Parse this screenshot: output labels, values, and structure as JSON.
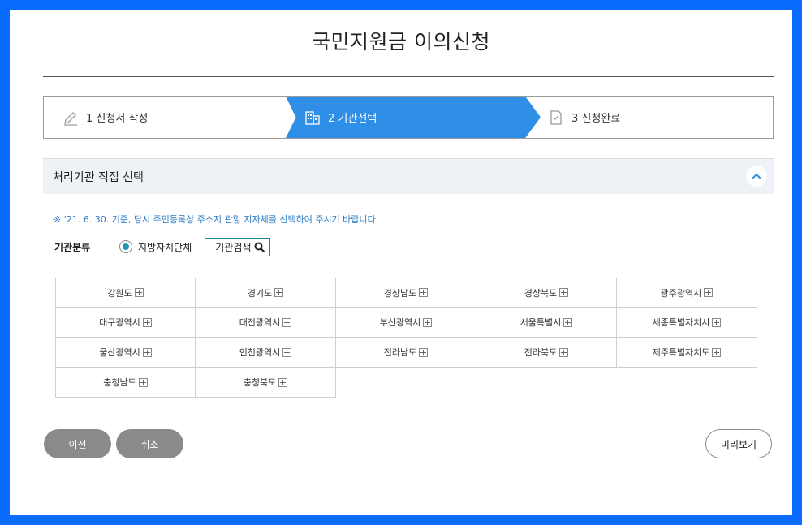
{
  "page": {
    "title": "국민지원금 이의신청"
  },
  "steps": [
    {
      "label": "1 신청서 작성",
      "icon": "pencil-icon",
      "active": false
    },
    {
      "label": "2 기관선택",
      "icon": "building-icon",
      "active": true
    },
    {
      "label": "3 신청완료",
      "icon": "document-check-icon",
      "active": false
    }
  ],
  "section": {
    "title": "처리기관 직접 선택",
    "notice": "※ '21. 6. 30. 기준, 당시 주민등록상 주소지 관할 지자체를 선택하여 주시기 바랍니다.",
    "org_label": "기관분류",
    "radio_label": "지방자치단체",
    "search_label": "기관검색"
  },
  "regions": [
    [
      "강원도",
      "경기도",
      "경상남도",
      "경상북도",
      "광주광역시"
    ],
    [
      "대구광역시",
      "대전광역시",
      "부산광역시",
      "서울특별시",
      "세종특별자치시"
    ],
    [
      "울산광역시",
      "인천광역시",
      "전라남도",
      "전라북도",
      "제주특별자치도"
    ],
    [
      "충청남도",
      "충청북도"
    ]
  ],
  "buttons": {
    "prev": "이전",
    "cancel": "취소",
    "preview": "미리보기"
  },
  "colors": {
    "frame": "#0a6cff",
    "active_step": "#2f8fe6",
    "notice": "#2a79c2",
    "radio": "#1a9ab0",
    "pill_button": "#8a8a8a"
  }
}
